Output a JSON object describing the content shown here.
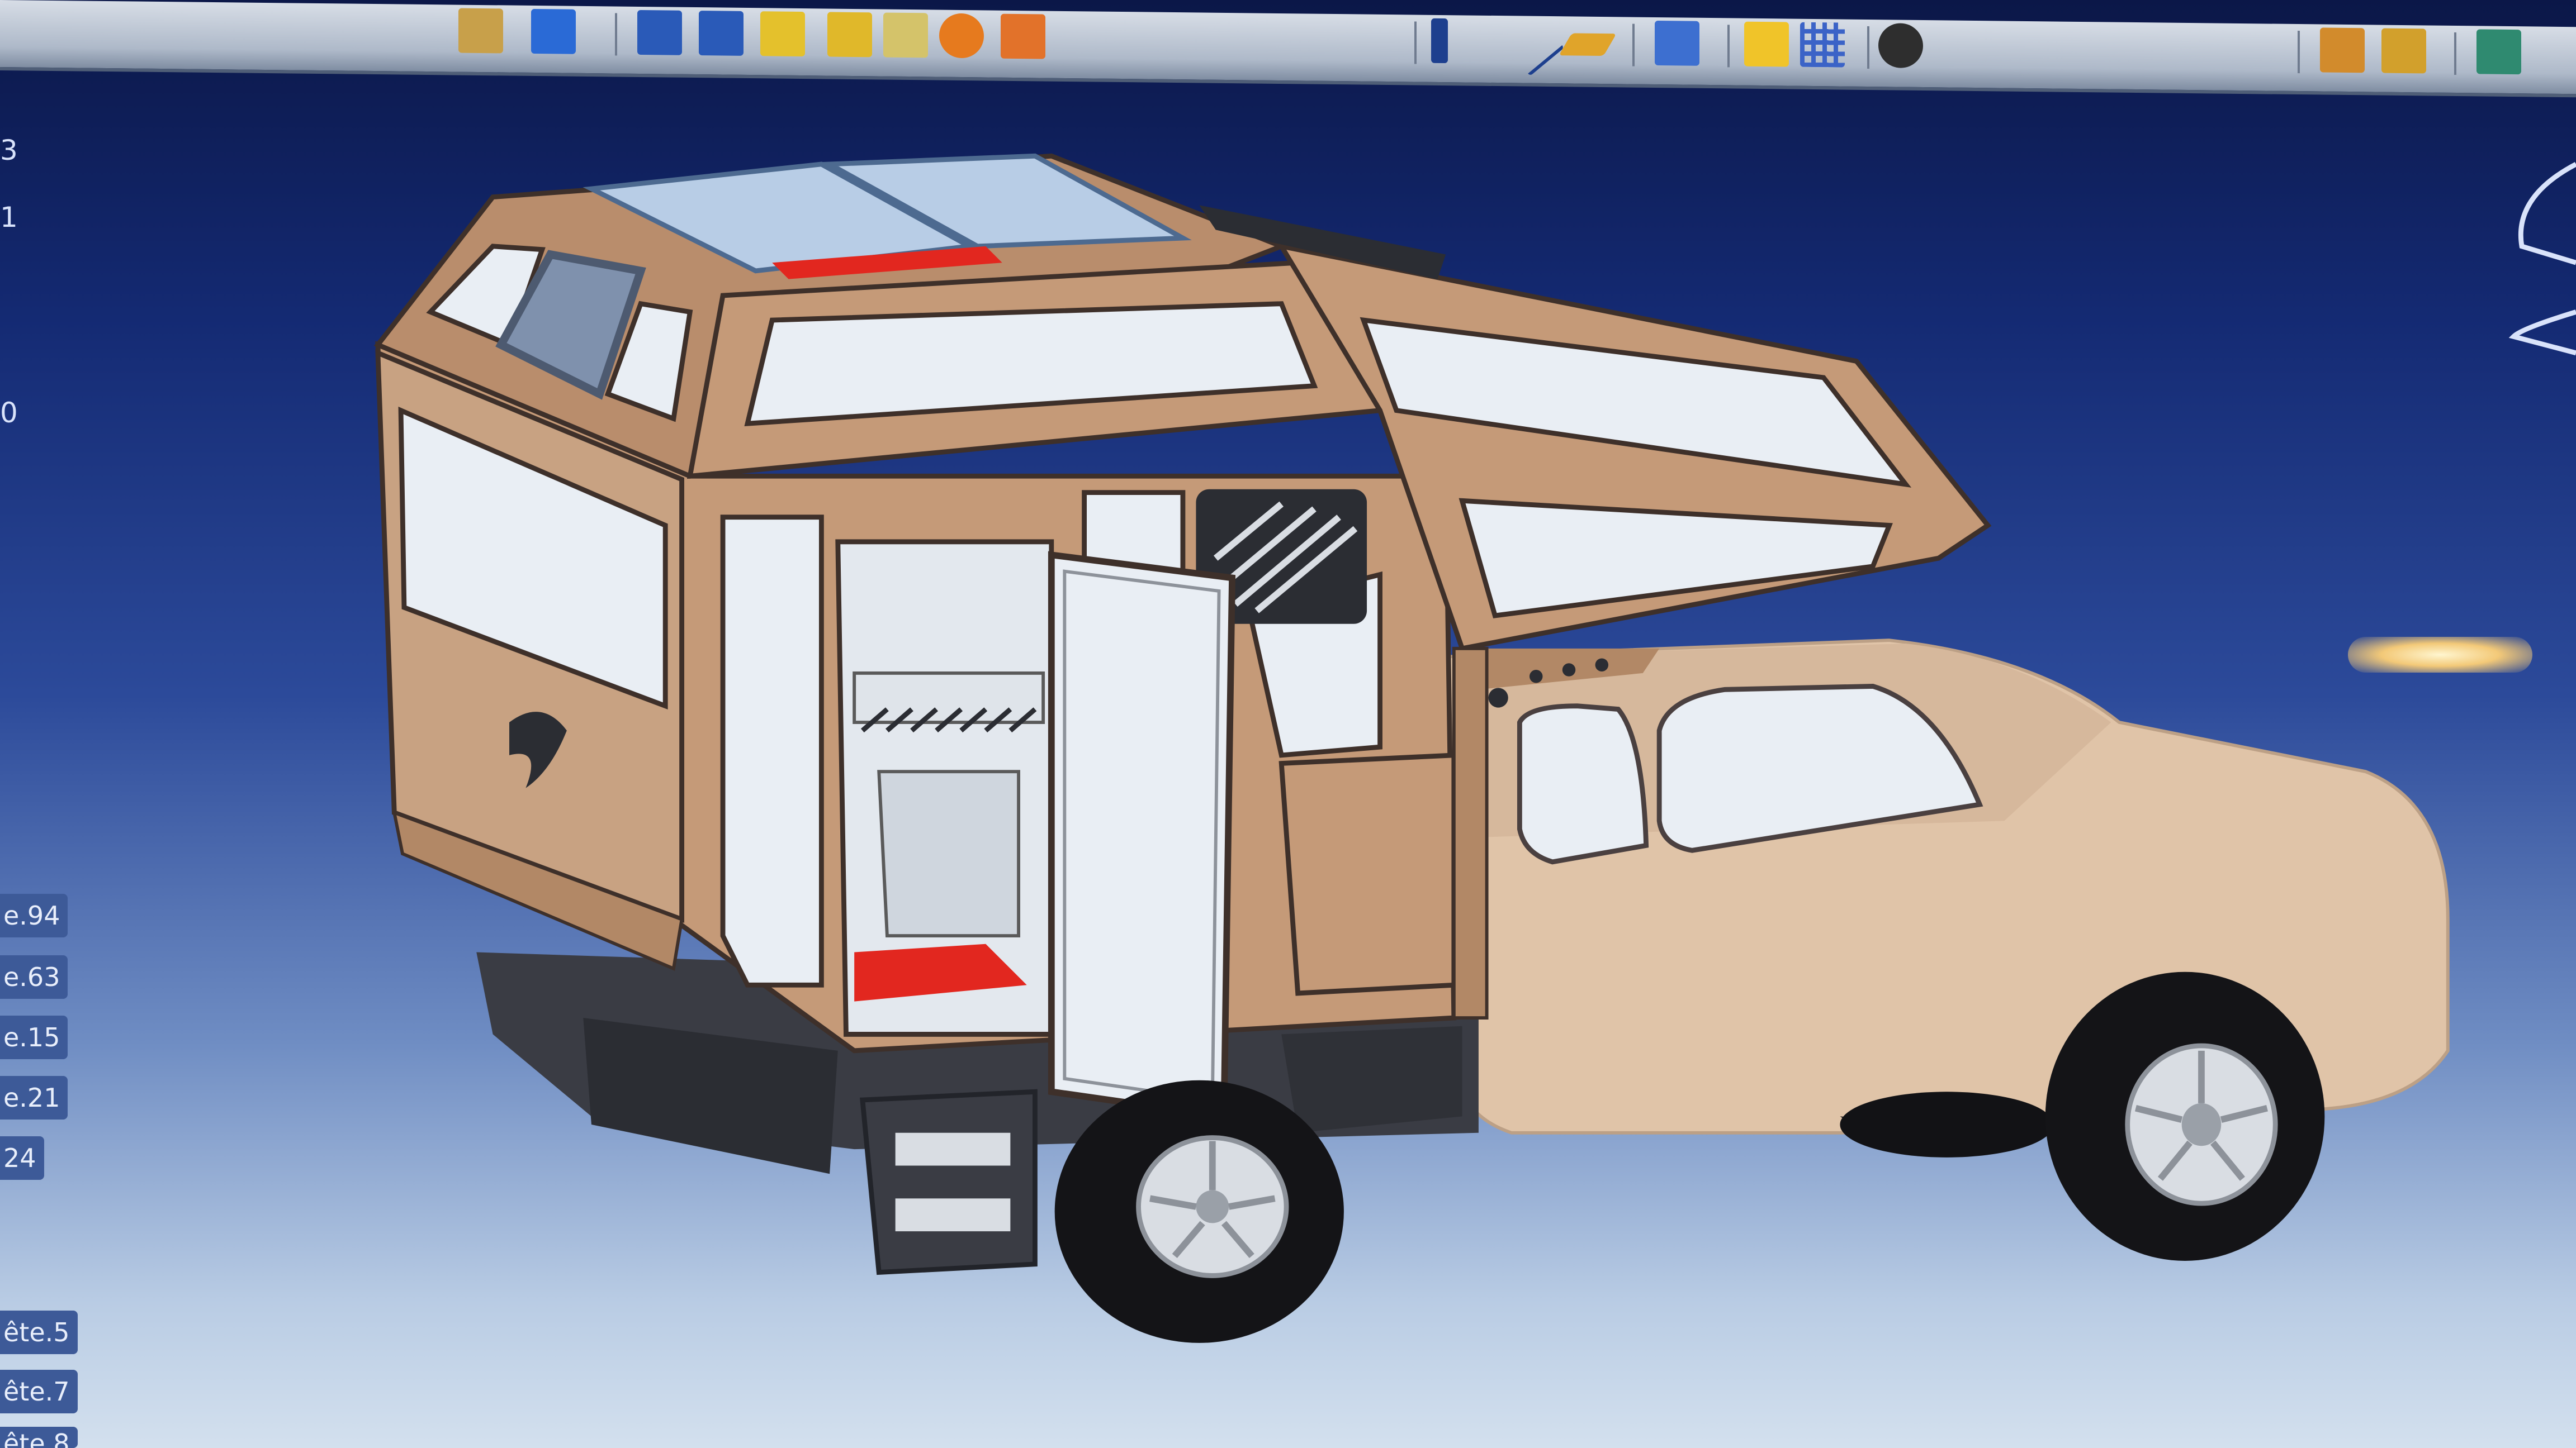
{
  "toolbar": {
    "buttons": [
      {
        "name": "part-design-icon",
        "color": "#c8a04a"
      },
      {
        "name": "cube-icon",
        "color": "#2a6ad6"
      },
      {
        "name": "cube-blue-icon",
        "color": "#2a5ab8"
      },
      {
        "name": "cube-yellow-icon",
        "color": "#e4c12c"
      },
      {
        "name": "pencil-icon",
        "color": "#e0b82a"
      },
      {
        "name": "measure-icon",
        "color": "#d4c36a"
      },
      {
        "name": "target-icon",
        "color": "#e67a1e"
      },
      {
        "name": "box-orange-icon",
        "color": "#e2722a"
      },
      {
        "name": "line-icon",
        "color": "#1d3f8e"
      },
      {
        "name": "plane-icon",
        "color": "#e0a42a"
      },
      {
        "name": "fixture-icon",
        "color": "#3d6fd0"
      },
      {
        "name": "assembly-icon",
        "color": "#f0c429"
      },
      {
        "name": "grid-icon",
        "color": "#3b63c7"
      },
      {
        "name": "snap-icon",
        "color": "#2e2e2e"
      },
      {
        "name": "layers-icon",
        "color": "#d28b2c"
      },
      {
        "name": "stack-icon",
        "color": "#d2a02c"
      },
      {
        "name": "book-icon",
        "color": "#2f8a70"
      }
    ]
  },
  "tree": {
    "numbers": [
      "3",
      "1",
      "0"
    ],
    "labels": [
      "e.94",
      "e.63",
      "e.15",
      "e.21",
      "24",
      "ête.5",
      "ête.7",
      "ête.8"
    ]
  },
  "model": {
    "camper_color": "#c59a78",
    "truck_color": "#e0c4a8",
    "window_color": "#e9eef4",
    "floor_color": "#e2271f"
  }
}
